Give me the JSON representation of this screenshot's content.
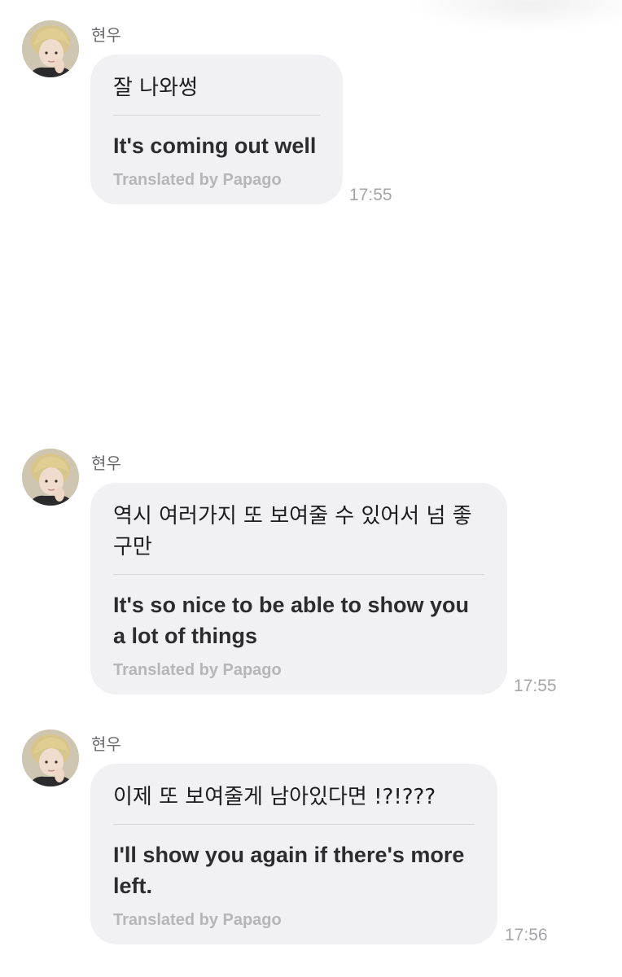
{
  "messages": [
    {
      "sender": "현우",
      "original": "잘 나와썽",
      "translation": "It's coming out well",
      "credit": "Translated by Papago",
      "time": "17:55"
    },
    {
      "sender": "현우",
      "original": "역시 여러가지 또 보여줄 수 있어서 넘 좋구만",
      "translation": "It's so nice to be able to show you a lot of things",
      "credit": "Translated by Papago",
      "time": "17:55"
    },
    {
      "sender": "현우",
      "original": "이제 또 보여줄게 남아있다면 !?!???",
      "translation": "I'll show you again if there's more left.",
      "credit": "Translated by Papago",
      "time": "17:56"
    }
  ],
  "icons": {
    "avatar": "profile-photo"
  }
}
